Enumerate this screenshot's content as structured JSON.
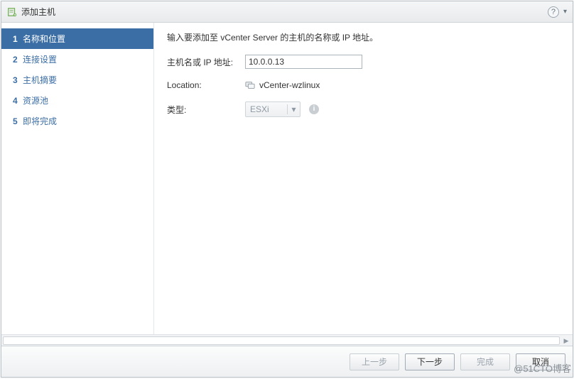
{
  "title": "添加主机",
  "help_tooltip": "?",
  "sidebar": {
    "steps": [
      {
        "num": "1",
        "label": "名称和位置",
        "active": true
      },
      {
        "num": "2",
        "label": "连接设置",
        "active": false
      },
      {
        "num": "3",
        "label": "主机摘要",
        "active": false
      },
      {
        "num": "4",
        "label": "资源池",
        "active": false
      },
      {
        "num": "5",
        "label": "即将完成",
        "active": false
      }
    ]
  },
  "content": {
    "intro": "输入要添加至 vCenter Server 的主机的名称或 IP 地址。",
    "host_label": "主机名或 IP 地址:",
    "host_value": "10.0.0.13",
    "location_label": "Location:",
    "location_value": "vCenter-wzlinux",
    "type_label": "类型:",
    "type_value": "ESXi"
  },
  "footer": {
    "back": "上一步",
    "next": "下一步",
    "finish": "完成",
    "cancel": "取消"
  },
  "watermark": "@51CTO博客"
}
